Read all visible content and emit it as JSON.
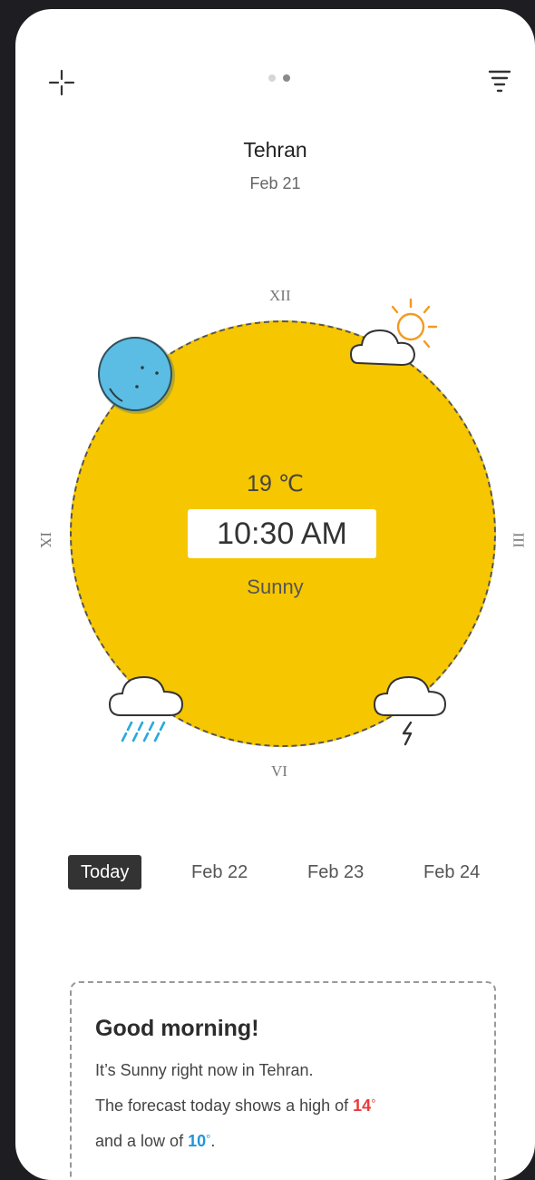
{
  "header": {
    "location": "Tehran",
    "date": "Feb 21",
    "page_dots": 2,
    "active_dot": 1
  },
  "clock": {
    "marks": {
      "top": "XII",
      "right": "III",
      "bottom": "VI",
      "left": "IX"
    },
    "temperature": "19 ℃",
    "time": "10:30 AM",
    "condition": "Sunny",
    "icons": {
      "top_right": "partly-sunny-icon",
      "top_left": "moon-icon",
      "bottom_left": "rain-cloud-icon",
      "bottom_right": "thunder-cloud-icon"
    }
  },
  "tabs": [
    {
      "label": "Today",
      "active": true
    },
    {
      "label": "Feb 22",
      "active": false
    },
    {
      "label": "Feb 23",
      "active": false
    },
    {
      "label": "Feb 24",
      "active": false
    }
  ],
  "summary": {
    "greeting": "Good morning!",
    "line1": "It’s Sunny right now in Tehran.",
    "line2_prefix": "The forecast today shows a high of ",
    "high": "14",
    "line3_prefix": "and a low of ",
    "low": "10",
    "degree": "°",
    "end": "."
  },
  "colors": {
    "sun": "#f6c600",
    "moon": "#5bbde3",
    "high": "#e83a3a",
    "low": "#2196d8"
  }
}
